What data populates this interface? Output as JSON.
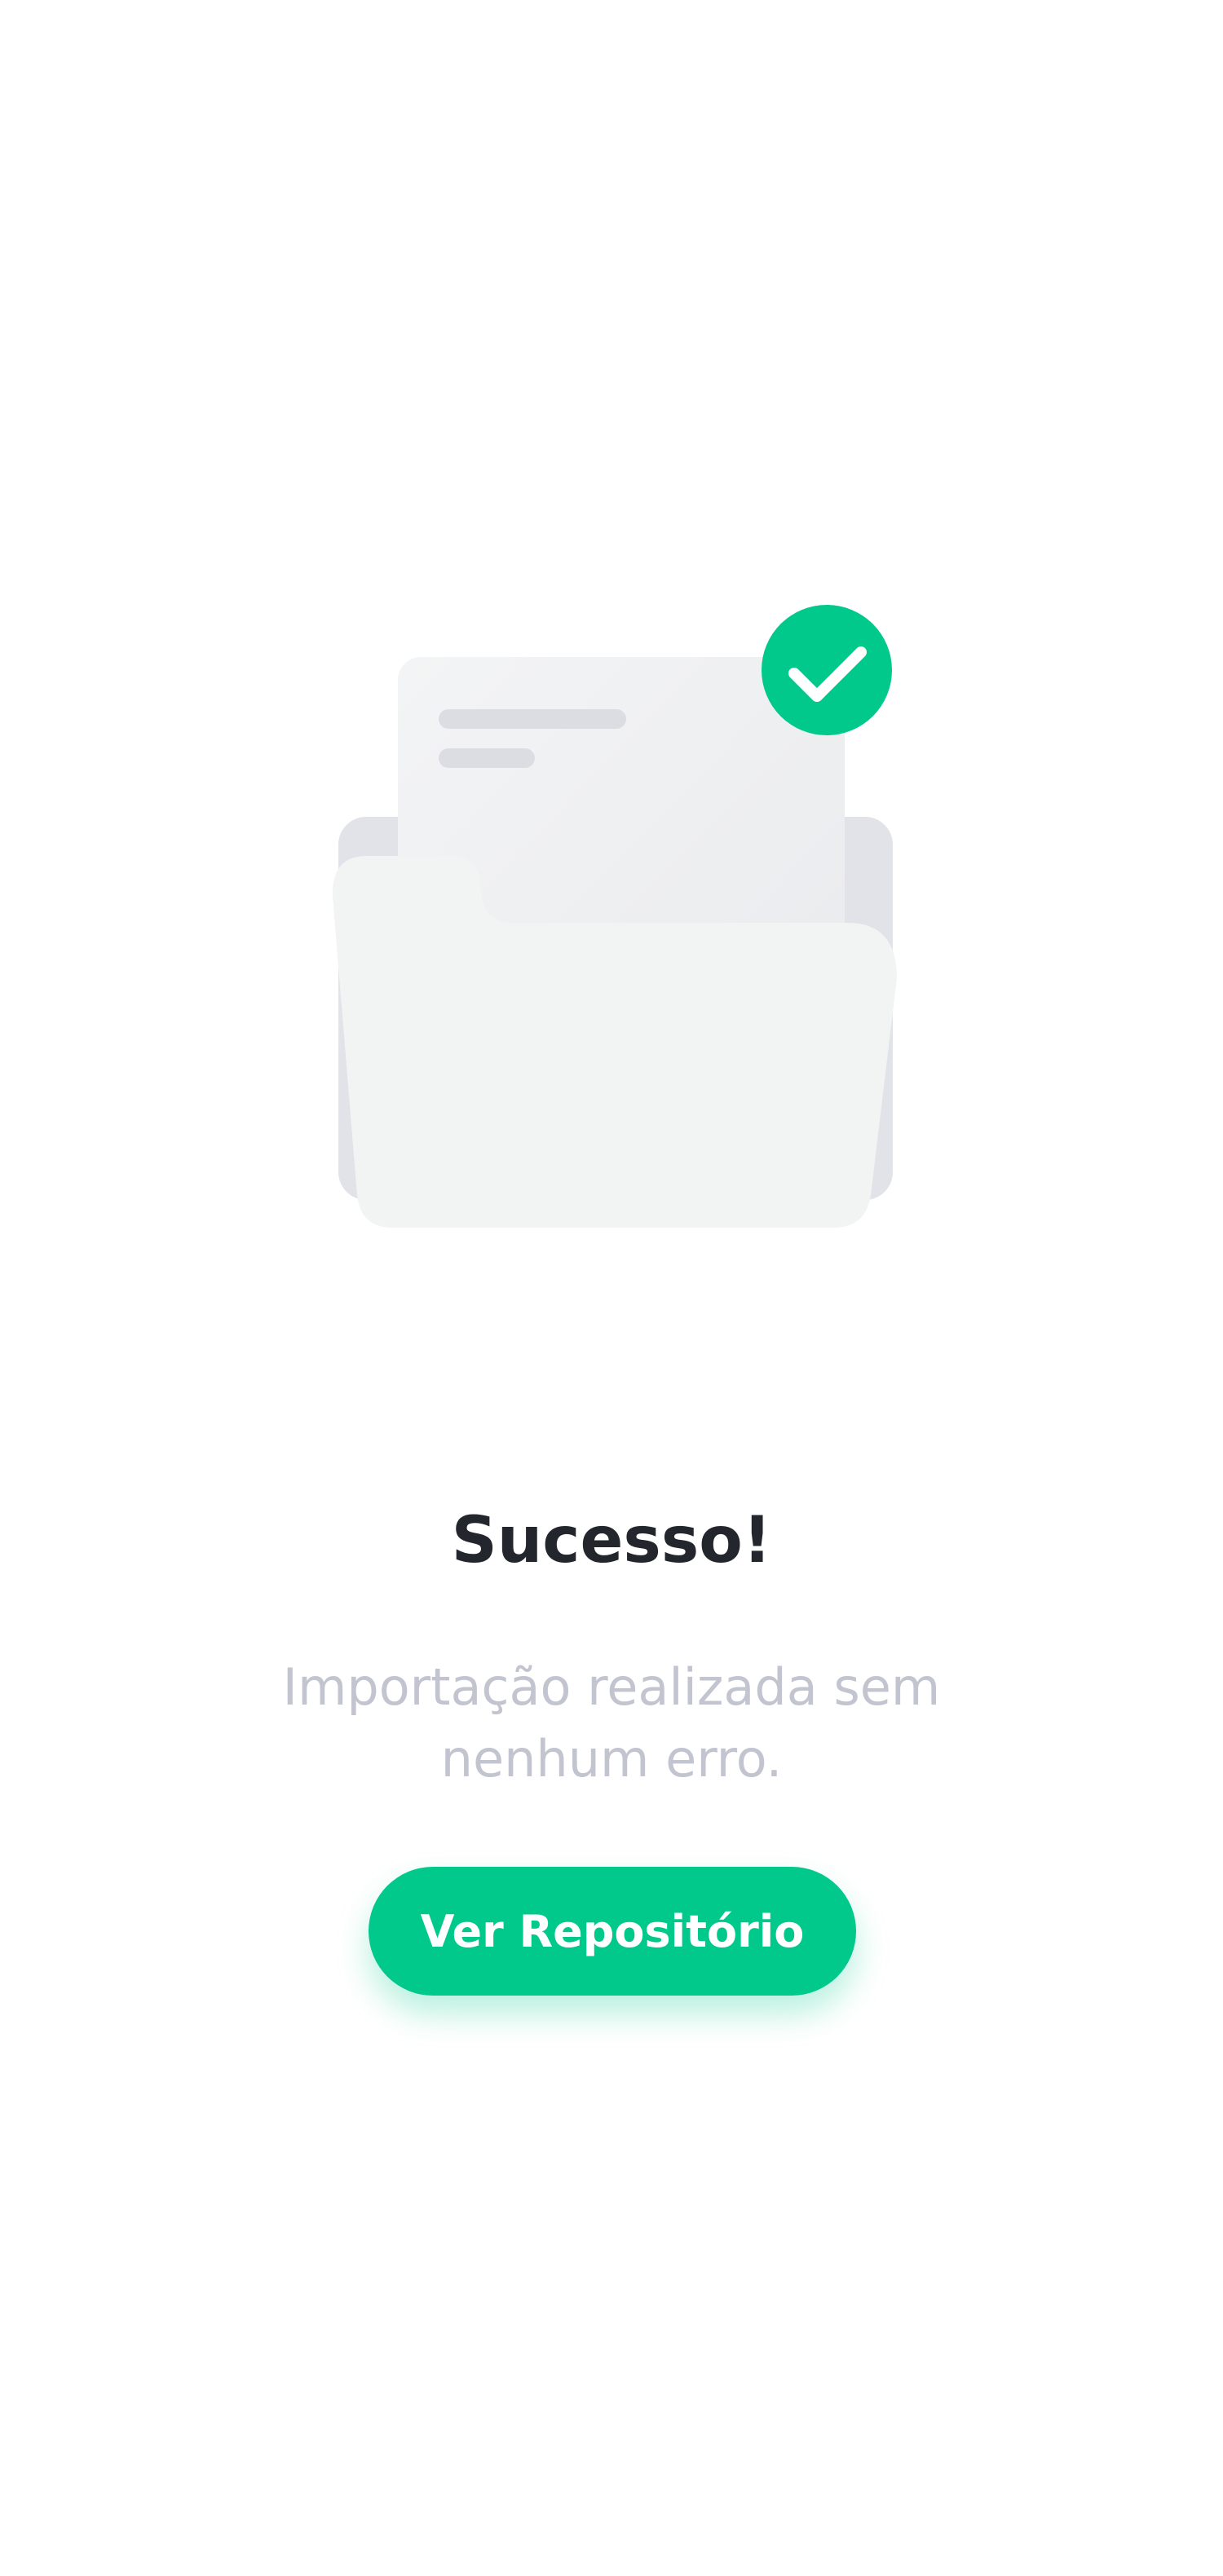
{
  "success": {
    "title": "Sucesso!",
    "message": "Importação realizada sem nenhum erro.",
    "button_label": "Ver Repositório"
  },
  "icons": {
    "illustration": "folder-with-document-icon",
    "badge": "check-circle-icon"
  },
  "colors": {
    "accent": "#00c98b",
    "title": "#23272d",
    "message": "#c2c4d0",
    "background": "#ffffff"
  }
}
